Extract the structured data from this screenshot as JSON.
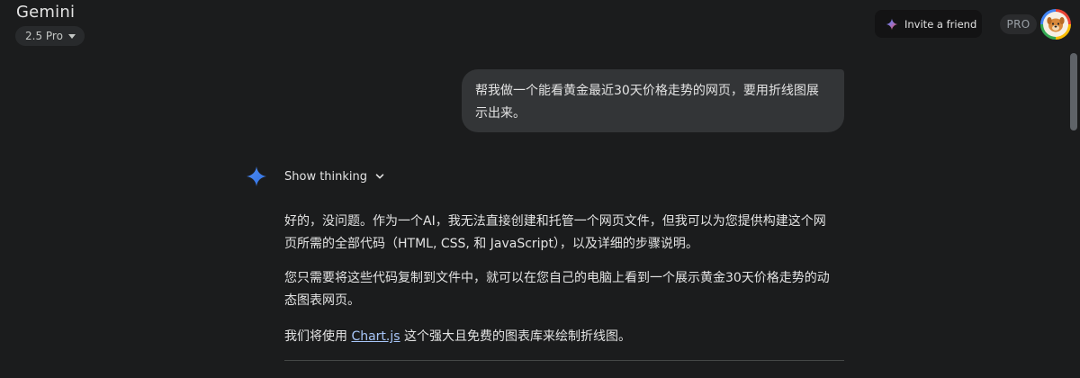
{
  "header": {
    "brand": "Gemini",
    "model": "2.5 Pro",
    "invite_label": "Invite a friend",
    "pro_badge": "PRO"
  },
  "user_message": {
    "line1": "帮我做一个能看黄金最近30天价格走势的网页，要用折线图展",
    "line2": "示出来。"
  },
  "response": {
    "thinking_label": "Show thinking",
    "p1_line1": "好的，没问题。作为一个AI，我无法直接创建和托管一个网页文件，但我可以为您提供构建这个网",
    "p1_line2": "页所需的全部代码（HTML, CSS, 和 JavaScript），以及详细的步骤说明。",
    "p2_line1": "您只需要将这些代码复制到文件中，就可以在您自己的电脑上看到一个展示黄金30天价格走势的动",
    "p2_line2": "态图表网页。",
    "p3_before": "我们将使用 ",
    "p3_link": "Chart.js",
    "p3_after": " 这个强大且免费的图表库来绘制折线图。"
  },
  "colors": {
    "background": "#1b1c1d",
    "bubble": "#333537",
    "link": "#a8c7fa",
    "spark": "#4285f4"
  }
}
